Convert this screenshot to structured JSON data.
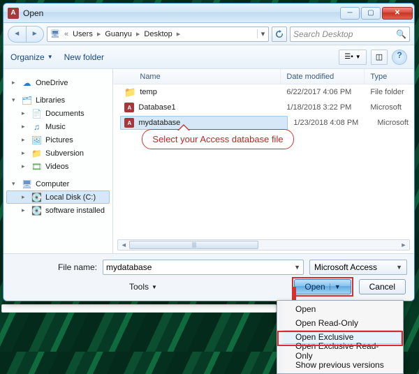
{
  "title": "Open",
  "breadcrumb": [
    "Users",
    "Guanyu",
    "Desktop"
  ],
  "search_placeholder": "Search Desktop",
  "toolbar": {
    "organize": "Organize",
    "newfolder": "New folder"
  },
  "navpane": [
    {
      "kind": "root",
      "icon": "onedrive",
      "label": "OneDrive",
      "expand": "closed"
    },
    {
      "kind": "root",
      "icon": "lib",
      "label": "Libraries",
      "expand": "open"
    },
    {
      "kind": "child",
      "icon": "doc",
      "label": "Documents"
    },
    {
      "kind": "child",
      "icon": "music",
      "label": "Music"
    },
    {
      "kind": "child",
      "icon": "pic",
      "label": "Pictures"
    },
    {
      "kind": "child",
      "icon": "svn",
      "label": "Subversion"
    },
    {
      "kind": "child",
      "icon": "vid",
      "label": "Videos"
    },
    {
      "kind": "root",
      "icon": "comp",
      "label": "Computer",
      "expand": "open"
    },
    {
      "kind": "child-sel",
      "icon": "disk",
      "label": "Local Disk (C:)"
    },
    {
      "kind": "child",
      "icon": "disk",
      "label": "software installed"
    }
  ],
  "columns": {
    "name": "Name",
    "date": "Date modified",
    "type": "Type"
  },
  "files": [
    {
      "icon": "folder",
      "name": "temp",
      "date": "6/22/2017 4:06 PM",
      "type": "File folder"
    },
    {
      "icon": "access",
      "name": "Database1",
      "date": "1/18/2018 3:22 PM",
      "type": "Microsoft"
    },
    {
      "icon": "access",
      "name": "mydatabase",
      "date": "1/23/2018 4:08 PM",
      "type": "Microsoft",
      "selected": true
    }
  ],
  "callout": "Select your Access database file",
  "filename_label": "File name:",
  "filename_value": "mydatabase",
  "filter_value": "Microsoft Access",
  "tools_label": "Tools",
  "open_label": "Open",
  "cancel_label": "Cancel",
  "menu": {
    "items": [
      "Open",
      "Open Read-Only",
      "Open Exclusive",
      "Open Exclusive Read-Only",
      "Show previous versions"
    ],
    "highlight_index": 2
  }
}
